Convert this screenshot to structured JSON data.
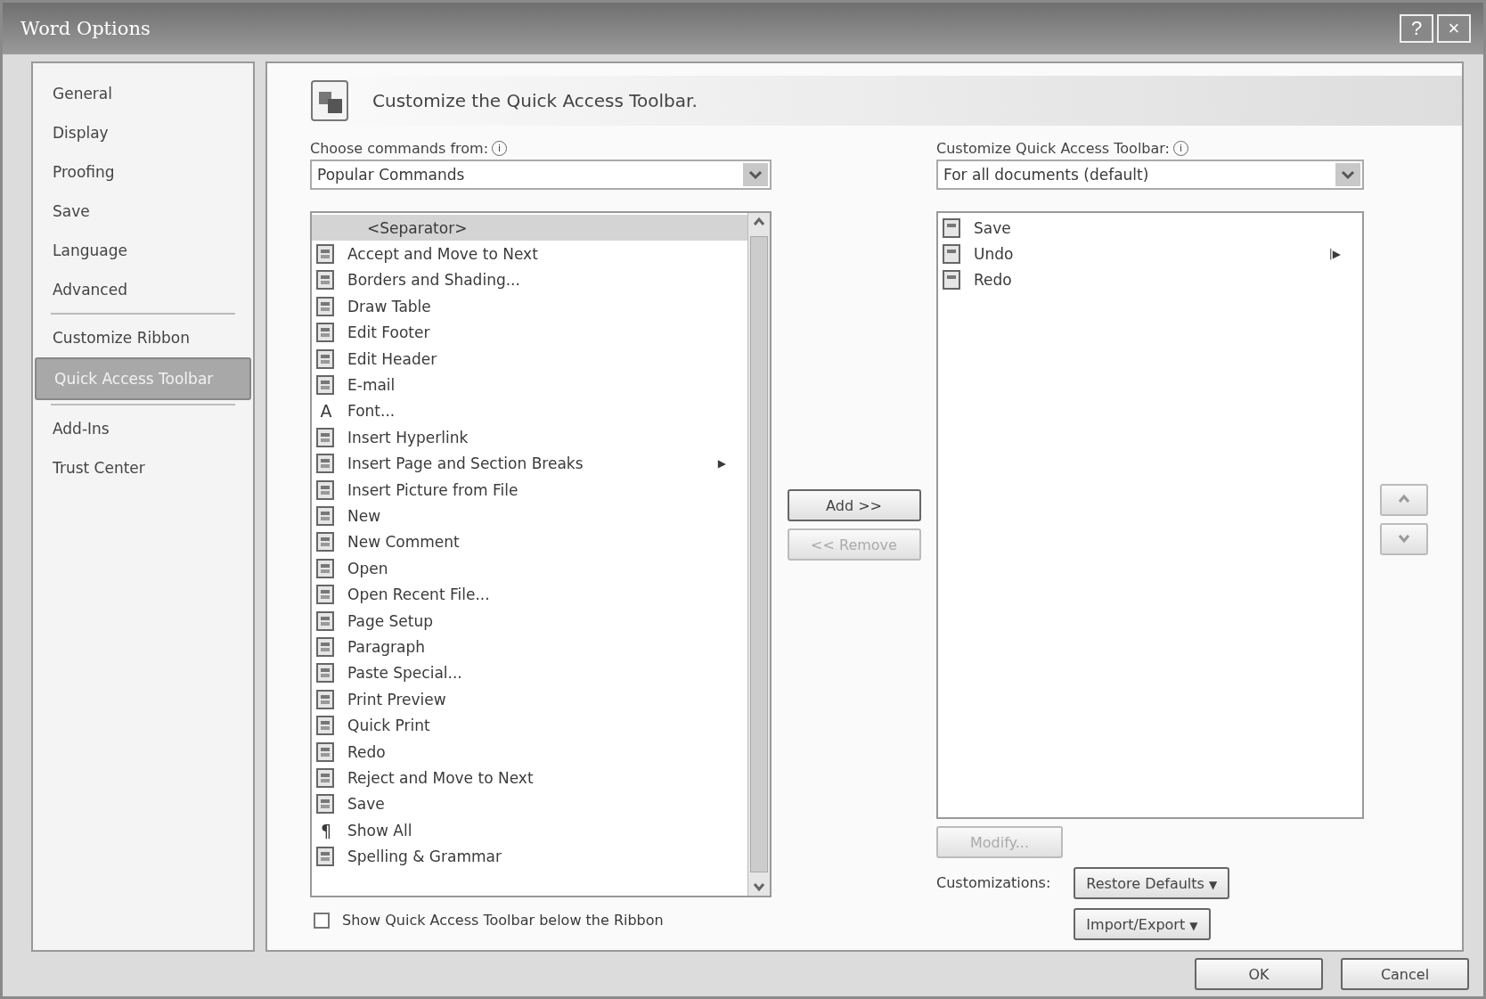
{
  "window": {
    "title": "Word Options",
    "help": "?",
    "close": "×"
  },
  "sidebar": {
    "groups": [
      {
        "items": [
          {
            "label": "General",
            "selected": false
          },
          {
            "label": "Display",
            "selected": false
          },
          {
            "label": "Proofing",
            "selected": false
          },
          {
            "label": "Save",
            "selected": false
          },
          {
            "label": "Language",
            "selected": false
          },
          {
            "label": "Advanced",
            "selected": false
          }
        ]
      },
      {
        "items": [
          {
            "label": "Customize Ribbon",
            "selected": false
          },
          {
            "label": "Quick Access Toolbar",
            "selected": true
          }
        ]
      },
      {
        "items": [
          {
            "label": "Add-Ins",
            "selected": false
          },
          {
            "label": "Trust Center",
            "selected": false
          }
        ]
      }
    ]
  },
  "header": {
    "title": "Customize the Quick Access Toolbar."
  },
  "choose": {
    "label": "Choose commands from:",
    "info": "i",
    "value": "Popular Commands"
  },
  "commands": [
    {
      "label": "<Separator>",
      "kind": "separator",
      "selected": true
    },
    {
      "label": "Accept and Move to Next",
      "kind": "icon",
      "selected": false
    },
    {
      "label": "Borders and Shading...",
      "kind": "icon",
      "selected": false
    },
    {
      "label": "Draw Table",
      "kind": "icon",
      "selected": false
    },
    {
      "label": "Edit Footer",
      "kind": "icon",
      "selected": false
    },
    {
      "label": "Edit Header",
      "kind": "icon",
      "selected": false
    },
    {
      "label": "E-mail",
      "kind": "icon",
      "selected": false
    },
    {
      "label": "Font...",
      "kind": "glyph",
      "glyph": "A",
      "selected": false
    },
    {
      "label": "Insert Hyperlink",
      "kind": "icon",
      "selected": false
    },
    {
      "label": "Insert Page and Section Breaks",
      "kind": "icon",
      "submenu": "▶",
      "selected": false
    },
    {
      "label": "Insert Picture from File",
      "kind": "icon",
      "selected": false
    },
    {
      "label": "New",
      "kind": "icon",
      "selected": false
    },
    {
      "label": "New Comment",
      "kind": "icon",
      "selected": false
    },
    {
      "label": "Open",
      "kind": "icon",
      "selected": false
    },
    {
      "label": "Open Recent File...",
      "kind": "icon",
      "selected": false
    },
    {
      "label": "Page Setup",
      "kind": "icon",
      "selected": false
    },
    {
      "label": "Paragraph",
      "kind": "icon",
      "selected": false
    },
    {
      "label": "Paste Special...",
      "kind": "icon",
      "selected": false
    },
    {
      "label": "Print Preview",
      "kind": "icon",
      "selected": false
    },
    {
      "label": "Quick Print",
      "kind": "icon",
      "selected": false
    },
    {
      "label": "Redo",
      "kind": "icon",
      "selected": false
    },
    {
      "label": "Reject and Move to Next",
      "kind": "icon",
      "selected": false
    },
    {
      "label": "Save",
      "kind": "icon",
      "selected": false
    },
    {
      "label": "Show All",
      "kind": "glyph",
      "glyph": "¶",
      "selected": false
    },
    {
      "label": "Spelling & Grammar",
      "kind": "icon",
      "selected": false
    }
  ],
  "show_below": {
    "label": "Show Quick Access Toolbar below the Ribbon",
    "checked": false
  },
  "add_button": {
    "label": "Add >>",
    "disabled": false
  },
  "remove_button": {
    "label": "<< Remove",
    "disabled": true
  },
  "customize": {
    "label": "Customize Quick Access Toolbar:",
    "info": "i",
    "value": "For all documents (default)"
  },
  "toolbar_items": [
    {
      "label": "Save",
      "selected": false
    },
    {
      "label": "Undo",
      "submenu": "|▶",
      "selected": false
    },
    {
      "label": "Redo",
      "selected": false
    }
  ],
  "modify_button": {
    "label": "Modify...",
    "disabled": true
  },
  "customizations": {
    "label": "Customizations:",
    "buttons": [
      {
        "label": "Restore Defaults",
        "caret": "▼"
      },
      {
        "label": "Import/Export",
        "caret": "▼"
      }
    ]
  },
  "footer": {
    "buttons": [
      "OK",
      "Cancel"
    ]
  }
}
